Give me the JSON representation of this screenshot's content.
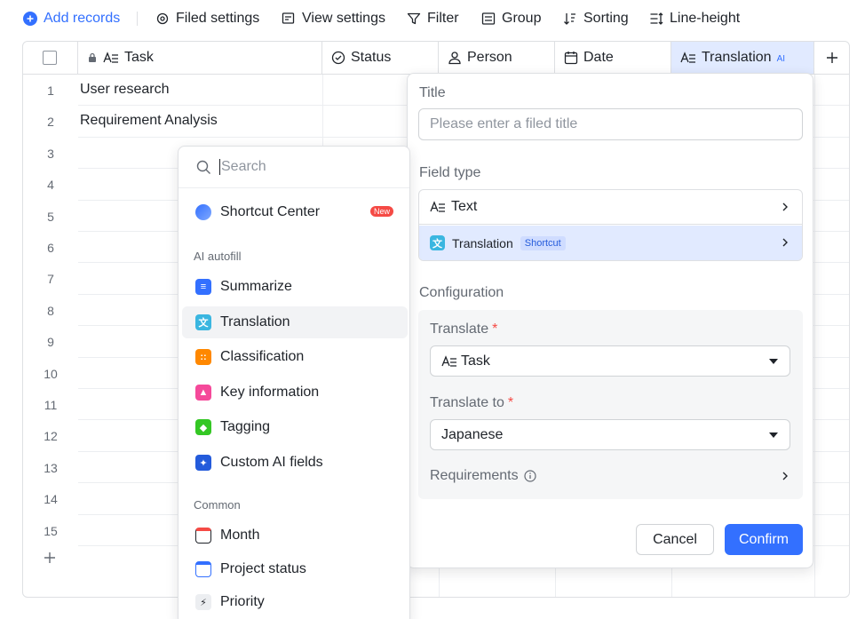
{
  "toolbar": {
    "add_records": "Add records",
    "filed_settings": "Filed settings",
    "view_settings": "View settings",
    "filter": "Filter",
    "group": "Group",
    "sorting": "Sorting",
    "line_height": "Line-height"
  },
  "table": {
    "columns": {
      "task": "Task",
      "status": "Status",
      "person": "Person",
      "date": "Date",
      "translation": "Translation",
      "translation_tag": "AI"
    },
    "rows": [
      {
        "n": "1",
        "task": "User research"
      },
      {
        "n": "2",
        "task": "Requirement Analysis"
      },
      {
        "n": "3",
        "task": ""
      },
      {
        "n": "4",
        "task": ""
      },
      {
        "n": "5",
        "task": ""
      },
      {
        "n": "6",
        "task": ""
      },
      {
        "n": "7",
        "task": ""
      },
      {
        "n": "8",
        "task": ""
      },
      {
        "n": "9",
        "task": ""
      },
      {
        "n": "10",
        "task": ""
      },
      {
        "n": "11",
        "task": ""
      },
      {
        "n": "12",
        "task": ""
      },
      {
        "n": "13",
        "task": ""
      },
      {
        "n": "14",
        "task": ""
      },
      {
        "n": "15",
        "task": ""
      }
    ]
  },
  "dropdown": {
    "search_placeholder": "Search",
    "shortcut_center": "Shortcut Center",
    "new_badge": "New",
    "ai_group": "AI autofill",
    "ai_items": [
      "Summarize",
      "Translation",
      "Classification",
      "Key information",
      "Tagging",
      "Custom AI fields"
    ],
    "common_group": "Common",
    "common_items": [
      "Month",
      "Project status",
      "Priority"
    ],
    "active_item": "Translation"
  },
  "panel": {
    "title_label": "Title",
    "title_placeholder": "Please enter a filed title",
    "field_type_label": "Field type",
    "field_type_text": "Text",
    "field_type_translation": "Translation",
    "shortcut_tag": "Shortcut",
    "configuration_label": "Configuration",
    "translate_label": "Translate",
    "translate_value": "Task",
    "translate_to_label": "Translate to",
    "translate_to_value": "Japanese",
    "requirements_label": "Requirements",
    "required_mark": "*",
    "cancel": "Cancel",
    "confirm": "Confirm"
  },
  "colors": {
    "accent": "#3370ff",
    "selected_bg": "#e1eaff",
    "required": "#f54a45"
  }
}
